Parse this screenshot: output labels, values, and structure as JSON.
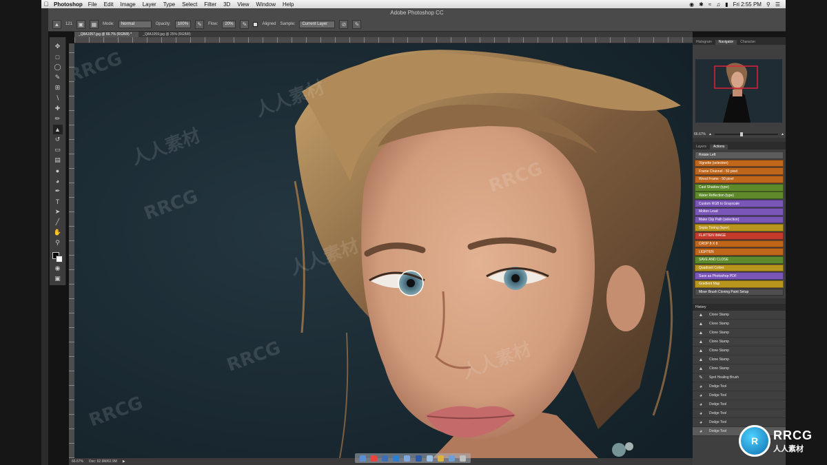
{
  "menubar": {
    "app_name": "Photoshop",
    "items": [
      "File",
      "Edit",
      "Image",
      "Layer",
      "Type",
      "Select",
      "Filter",
      "3D",
      "View",
      "Window",
      "Help"
    ],
    "clock": "Fri 2:55 PM"
  },
  "window": {
    "title": "Adobe Photoshop CC"
  },
  "options": {
    "brush_size": "121",
    "mode_label": "Mode:",
    "mode_value": "Normal",
    "opacity_label": "Opacity:",
    "opacity_value": "100%",
    "flow_label": "Flow:",
    "flow_value": "20%",
    "aligned_label": "Aligned",
    "sample_label": "Sample:",
    "sample_value": "Current Layer"
  },
  "tabs": [
    {
      "label": "_Q8A1057.jpg @ 66.7% (RGB/8) *",
      "active": true
    },
    {
      "label": "_Q8A1059.jpg @ 25% (RGB/8)",
      "active": false
    }
  ],
  "status": {
    "zoom": "66.67%",
    "doc": "Doc: 62.9M/62.9M"
  },
  "panels": {
    "top_tabs": [
      "Histogram",
      "Navigator",
      "Character"
    ],
    "navigator_zoom": "66.67%",
    "mid_tabs": [
      "Layers",
      "Actions"
    ],
    "actions": [
      {
        "label": "Rotate Left",
        "color": "#5c5c5c"
      },
      {
        "label": "Vignette (selection)",
        "color": "#c0661a"
      },
      {
        "label": "Frame Channel - 50 pixel",
        "color": "#c0661a"
      },
      {
        "label": "Wood Frame - 50 pixel",
        "color": "#c0661a"
      },
      {
        "label": "Cast Shadow (type)",
        "color": "#5e8a2c"
      },
      {
        "label": "Water Reflection (type)",
        "color": "#5e8a2c"
      },
      {
        "label": "Custom RGB to Grayscale",
        "color": "#7a56b8"
      },
      {
        "label": "Molten Lead",
        "color": "#7a56b8"
      },
      {
        "label": "Make Clip Path (selection)",
        "color": "#7a56b8"
      },
      {
        "label": "Sepia Toning (layer)",
        "color": "#b8951c"
      },
      {
        "label": "FLATTEN IMAGE",
        "color": "#c33a2a"
      },
      {
        "label": "CROP 8 X 8",
        "color": "#c0661a"
      },
      {
        "label": "LIGHTEN",
        "color": "#c0661a"
      },
      {
        "label": "SAVE AND CLOSE",
        "color": "#5e8a2c"
      },
      {
        "label": "Quadrant Colors",
        "color": "#b8951c"
      },
      {
        "label": "Save as Photoshop PDF",
        "color": "#7a56b8"
      },
      {
        "label": "Gradient Map",
        "color": "#b8951c"
      },
      {
        "label": "Mixer Brush Cloning Paint Setup",
        "color": "#4e4e4e"
      }
    ],
    "history_title": "History",
    "history": [
      {
        "label": "Clone Stamp",
        "icon": "clone-stamp-icon",
        "active": false
      },
      {
        "label": "Clone Stamp",
        "icon": "clone-stamp-icon",
        "active": false
      },
      {
        "label": "Clone Stamp",
        "icon": "clone-stamp-icon",
        "active": false
      },
      {
        "label": "Clone Stamp",
        "icon": "clone-stamp-icon",
        "active": false
      },
      {
        "label": "Clone Stamp",
        "icon": "clone-stamp-icon",
        "active": false
      },
      {
        "label": "Clone Stamp",
        "icon": "clone-stamp-icon",
        "active": false
      },
      {
        "label": "Clone Stamp",
        "icon": "clone-stamp-icon",
        "active": false
      },
      {
        "label": "Spot Healing Brush",
        "icon": "healing-brush-icon",
        "active": false
      },
      {
        "label": "Dodge Tool",
        "icon": "dodge-tool-icon",
        "active": false
      },
      {
        "label": "Dodge Tool",
        "icon": "dodge-tool-icon",
        "active": false
      },
      {
        "label": "Dodge Tool",
        "icon": "dodge-tool-icon",
        "active": false
      },
      {
        "label": "Dodge Tool",
        "icon": "dodge-tool-icon",
        "active": false
      },
      {
        "label": "Dodge Tool",
        "icon": "dodge-tool-icon",
        "active": false
      },
      {
        "label": "Dodge Tool",
        "icon": "dodge-tool-icon",
        "active": true
      }
    ]
  },
  "watermark": {
    "text": "RRCG",
    "cn": "人人素材"
  },
  "brand": {
    "logo": "RRCG",
    "tagline": "人人素材"
  }
}
